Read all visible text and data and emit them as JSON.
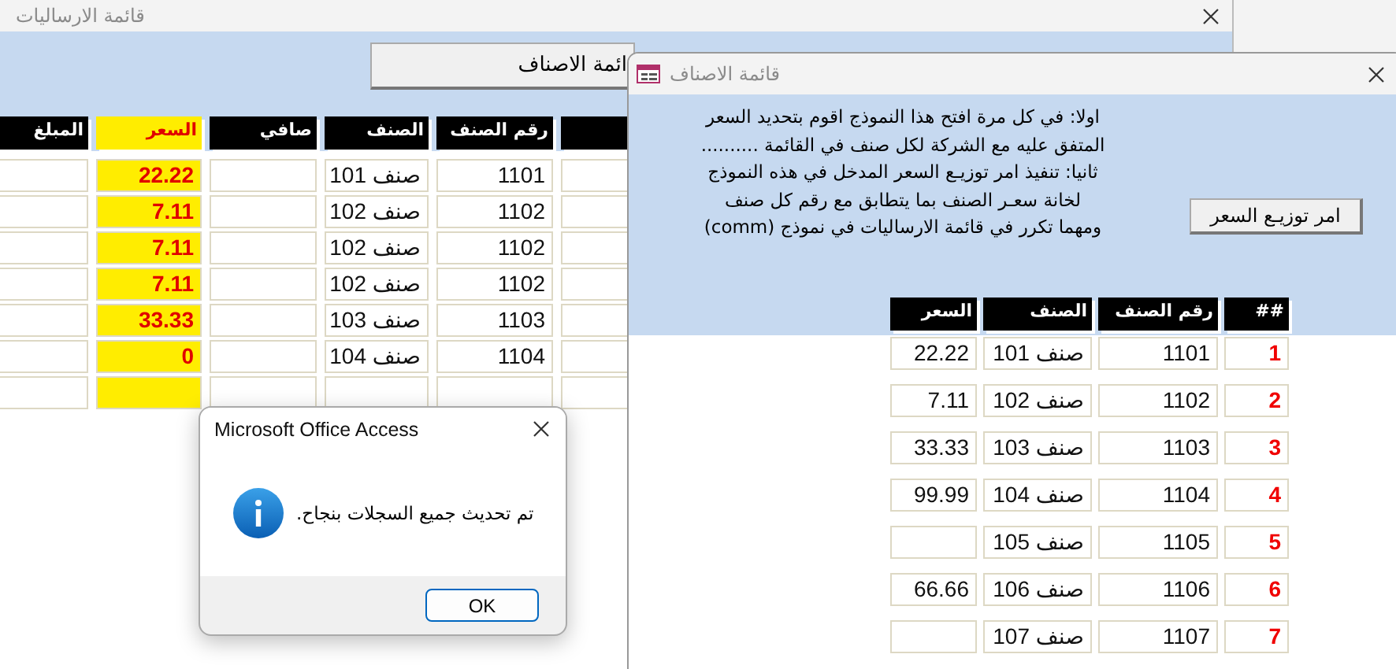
{
  "back_window": {
    "title": "قائمة الارساليات",
    "button": "ائمة الاصناف",
    "columns": [
      {
        "kind": "blank"
      },
      {
        "kind": "plain",
        "label": "رقم الصنف"
      },
      {
        "kind": "plain",
        "label": "الصنف"
      },
      {
        "kind": "plain",
        "label": "صافي"
      },
      {
        "kind": "highlight",
        "label": "السعر"
      },
      {
        "kind": "plain",
        "label": "المبلغ"
      }
    ],
    "rows": [
      {
        "item_no": "1101",
        "item": "صنف 101",
        "price": "22.22"
      },
      {
        "item_no": "1102",
        "item": "صنف 102",
        "price": "7.11"
      },
      {
        "item_no": "1102",
        "item": "صنف 102",
        "price": "7.11"
      },
      {
        "item_no": "1102",
        "item": "صنف 102",
        "price": "7.11"
      },
      {
        "item_no": "1103",
        "item": "صنف 103",
        "price": "33.33"
      },
      {
        "item_no": "1104",
        "item": "صنف 104",
        "price": "0"
      }
    ],
    "new_record_row": true
  },
  "front_window": {
    "title": "قائمة الاصناف",
    "instructions": "اولا: في كل مرة افتح هذا النموذج اقوم بتحديد السعر\nالمتفق عليه مع الشركة  لكل صنف في القائمة ..........\nثانيا: تنفيذ امر توزيـع السعر المدخل في هذه النموذج\nلخانة سعـر الصنف  بما يتطابق مع رقم كل صنف\nومهما تكرر في قائمة الارساليات في نموذج (comm)",
    "button": "امر توزيـع السعر",
    "columns": [
      {
        "kind": "index",
        "label": "##"
      },
      {
        "kind": "plain",
        "label": "رقم الصنف"
      },
      {
        "kind": "plain",
        "label": "الصنف"
      },
      {
        "kind": "plain",
        "label": "السعر"
      }
    ],
    "rows": [
      {
        "no": "1",
        "item_no": "1101",
        "item": "صنف 101",
        "price": "22.22"
      },
      {
        "no": "2",
        "item_no": "1102",
        "item": "صنف 102",
        "price": "7.11"
      },
      {
        "no": "3",
        "item_no": "1103",
        "item": "صنف 103",
        "price": "33.33"
      },
      {
        "no": "4",
        "item_no": "1104",
        "item": "صنف 104",
        "price": "99.99"
      },
      {
        "no": "5",
        "item_no": "1105",
        "item": "صنف 105"
      },
      {
        "no": "6",
        "item_no": "1106",
        "item": "صنف 106",
        "price": "66.66"
      },
      {
        "no": "7",
        "item_no": "1107",
        "item": "صنف 107"
      }
    ]
  },
  "dialog": {
    "title": "Microsoft Office Access",
    "message": "تم تحديث جميع السجلات بنجاح.",
    "button": "OK"
  }
}
